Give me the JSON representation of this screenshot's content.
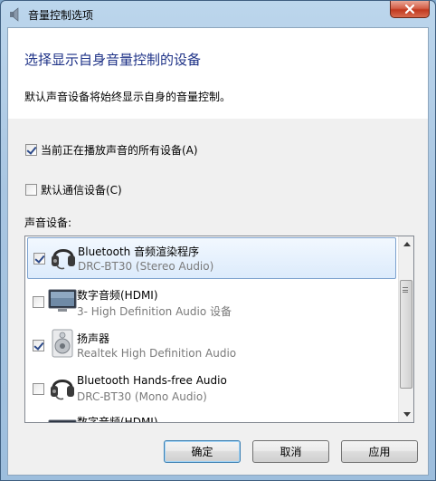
{
  "window": {
    "title": "音量控制选项"
  },
  "header": {
    "heading": "选择显示自身音量控制的设备",
    "description": "默认声音设备将始终显示自身的音量控制。"
  },
  "options": {
    "all_playing": {
      "label": "当前正在播放声音的所有设备(A)",
      "checked": true
    },
    "default_comm": {
      "label": "默认通信设备(C)",
      "checked": false
    }
  },
  "devices_label": "声音设备:",
  "devices": [
    {
      "name": "Bluetooth 音频渲染程序",
      "sub": "DRC-BT30 (Stereo Audio)",
      "checked": true,
      "icon": "headset-icon",
      "selected": true
    },
    {
      "name": "数字音频(HDMI)",
      "sub": "3- High Definition Audio 设备",
      "checked": false,
      "icon": "monitor-icon",
      "selected": false
    },
    {
      "name": "扬声器",
      "sub": "Realtek High Definition Audio",
      "checked": true,
      "icon": "speaker-icon",
      "selected": false
    },
    {
      "name": "Bluetooth Hands-free Audio",
      "sub": "DRC-BT30 (Mono Audio)",
      "checked": false,
      "icon": "headset-icon",
      "selected": false
    },
    {
      "name": "数字音频(HDMI)",
      "sub": "",
      "checked": false,
      "icon": "monitor-icon",
      "selected": false
    }
  ],
  "buttons": {
    "ok": "确定",
    "cancel": "取消",
    "apply": "应用"
  },
  "colors": {
    "heading": "#1e3287",
    "subtext": "#7a7a7a",
    "close": "#c1391f"
  }
}
